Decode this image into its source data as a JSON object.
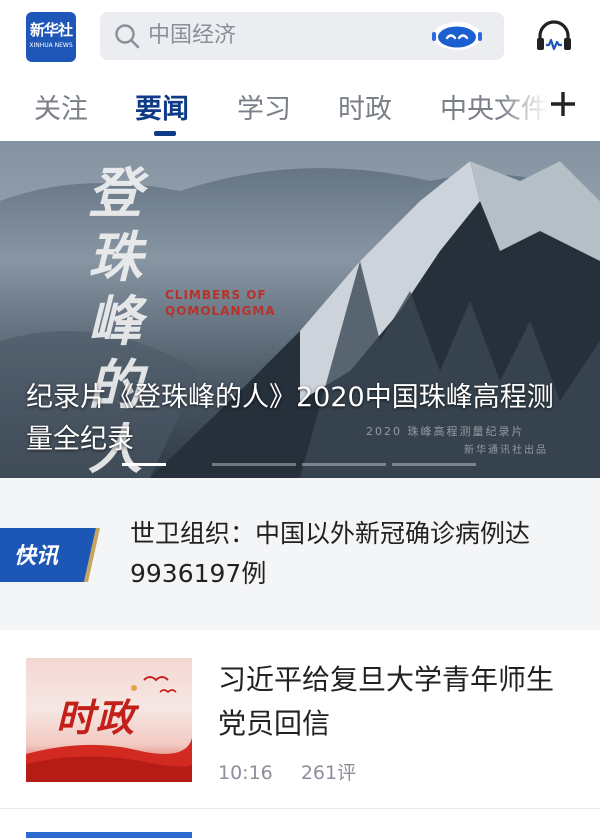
{
  "app": {
    "logo_cn": "新华社",
    "logo_en": "XINHUA NEWS"
  },
  "search": {
    "placeholder": "中国经济",
    "robot_icon": "assistant-robot-icon"
  },
  "header": {
    "audio_icon": "headphones-icon"
  },
  "tabs": [
    {
      "label": "关注",
      "active": false
    },
    {
      "label": "要闻",
      "active": true
    },
    {
      "label": "学习",
      "active": false
    },
    {
      "label": "时政",
      "active": false
    },
    {
      "label": "中央文件",
      "active": false
    }
  ],
  "banner": {
    "calligraphy": "登珠峰的人",
    "english_title": "CLIMBERS OF QOMOLANGMA",
    "caption": "纪录片《登珠峰的人》2020中国珠峰高程测量全纪录",
    "watermark_line1": "2020 珠峰高程测量纪录片",
    "watermark_line2": "新华通讯社出品",
    "page_count": 4,
    "active_index": 0
  },
  "flash": {
    "badge": "快讯",
    "text": "世卫组织：中国以外新冠确诊病例达9936197例"
  },
  "news": [
    {
      "thumb_label": "时政",
      "title": "习近平给复旦大学青年师生党员回信",
      "time": "10:16",
      "comments": "261评"
    }
  ],
  "colors": {
    "brand_blue": "#1f57b8",
    "tab_active": "#0e3a87",
    "tab_inactive": "#7a7f88",
    "badge_blue": "#1d57b5",
    "thumb_red": "#c4201a"
  }
}
